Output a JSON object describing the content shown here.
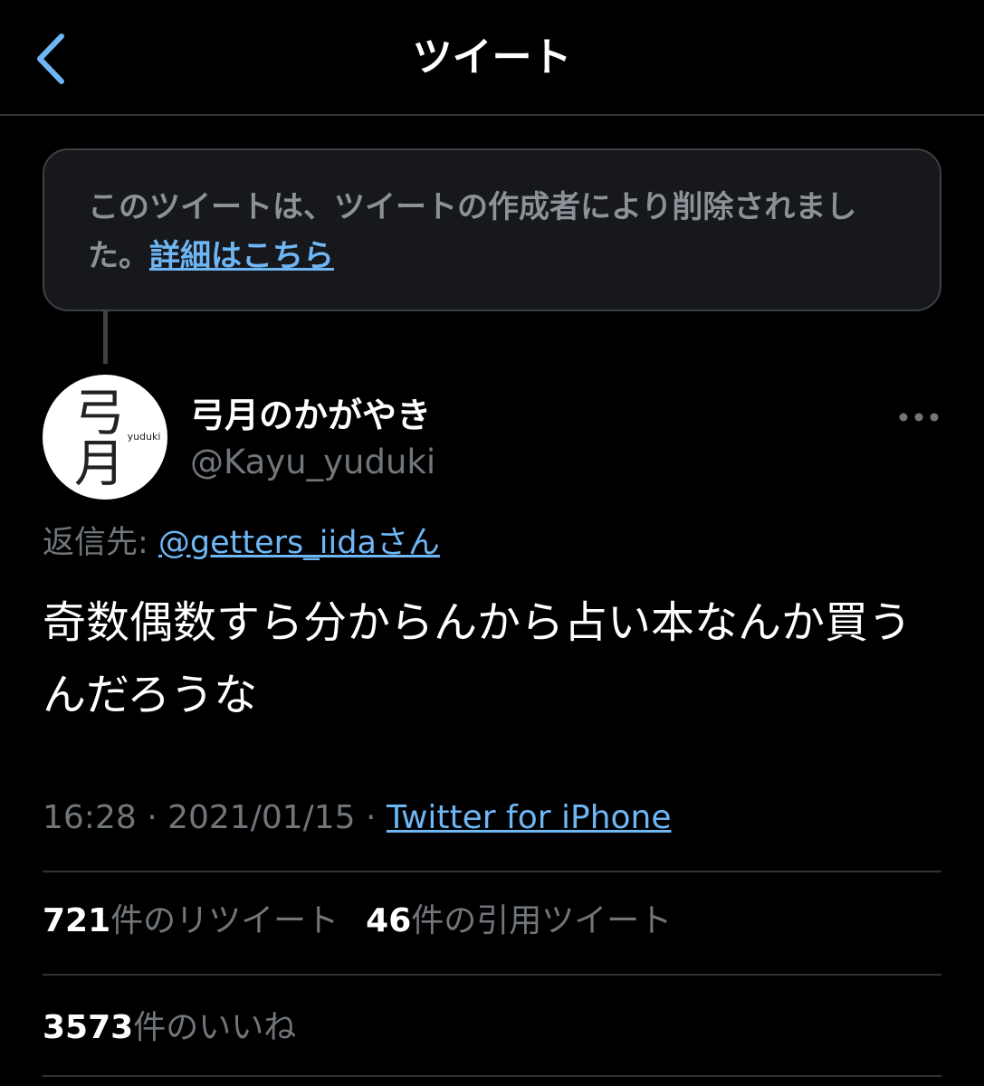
{
  "header": {
    "title": "ツイート",
    "back_icon": "chevron-left-icon"
  },
  "deleted_notice": {
    "text": "このツイートは、ツイートの作成者により削除されました。",
    "link_label": "詳細はこちら"
  },
  "tweet": {
    "avatar_text_large": "弓月",
    "avatar_text_small": "yuduki",
    "display_name": "弓月のかがやき",
    "handle": "@Kayu_yuduki",
    "reply_prefix": "返信先: ",
    "reply_to": "@getters_iidaさん",
    "text": "奇数偶数すら分からんから占い本なんか買うんだろうな",
    "time": "16:28",
    "separator": " · ",
    "date": "2021/01/15",
    "source": "Twitter for iPhone"
  },
  "stats": {
    "retweets_count": "721",
    "retweets_label": "件のリツイート",
    "quotes_count": "46",
    "quotes_label": "件の引用ツイート",
    "likes_count": "3573",
    "likes_label": "件のいいね"
  },
  "colors": {
    "background": "#000000",
    "link": "#6fb6f5",
    "secondary_text": "#71767b",
    "divider": "#2f3336"
  }
}
